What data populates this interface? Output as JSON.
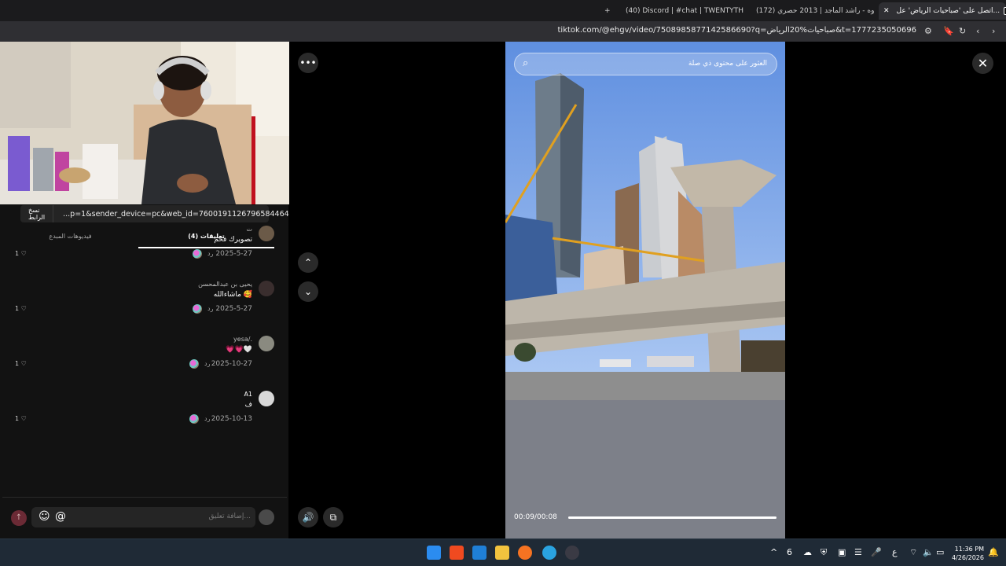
{
  "browser": {
    "tabs": [
      {
        "label": "اتصل على 'صباحيات الرياض' عل...",
        "active": true
      },
      {
        "label": "(172) غروه - راشد الماجد | 2013 حصري",
        "active": false
      },
      {
        "label": "(40) Discord | #chat | TWENTYTHE",
        "active": false
      }
    ],
    "new_tab": "+",
    "tab_close": "✕",
    "url": "tiktok.com/@ehgv/video/7508985877142586690?q=صباحيات%20الرياض&t=1777235050696"
  },
  "comments_panel": {
    "copy_link_label": "نسخ الرابط",
    "share_url": "...p=1&sender_device=pc&web_id=7600191126796584464",
    "tabs": {
      "comments": "تعليقات (4)",
      "creator_videos": "فيديوهات المبدع"
    },
    "reply_label": "رد",
    "comments": [
      {
        "name": "ت",
        "text": "تصويرك فخم",
        "date": "2025-5-27",
        "likes": "1"
      },
      {
        "name": "يحيى بن عبدالمحسن",
        "text": "ماشاءالله 🥰",
        "date": "2025-5-27",
        "likes": "1"
      },
      {
        "name": "yesa/.",
        "text": "💗💗🤍",
        "date": "2025-10-27",
        "likes": "1"
      },
      {
        "name": "A1",
        "text": "ف",
        "date": "2025-10-13",
        "likes": "1"
      }
    ],
    "composer_placeholder": "إضافة تعليق...",
    "mention_icon": "@",
    "emoji_icon": "☺"
  },
  "video": {
    "search_placeholder": "العثور على محتوى ذي صلة",
    "time": "00:09/00:08",
    "progress": 1.0
  },
  "taskbar": {
    "clock_time": "11:36 PM",
    "clock_date": "4/26/2026",
    "lang": "ع",
    "badge": "6"
  }
}
